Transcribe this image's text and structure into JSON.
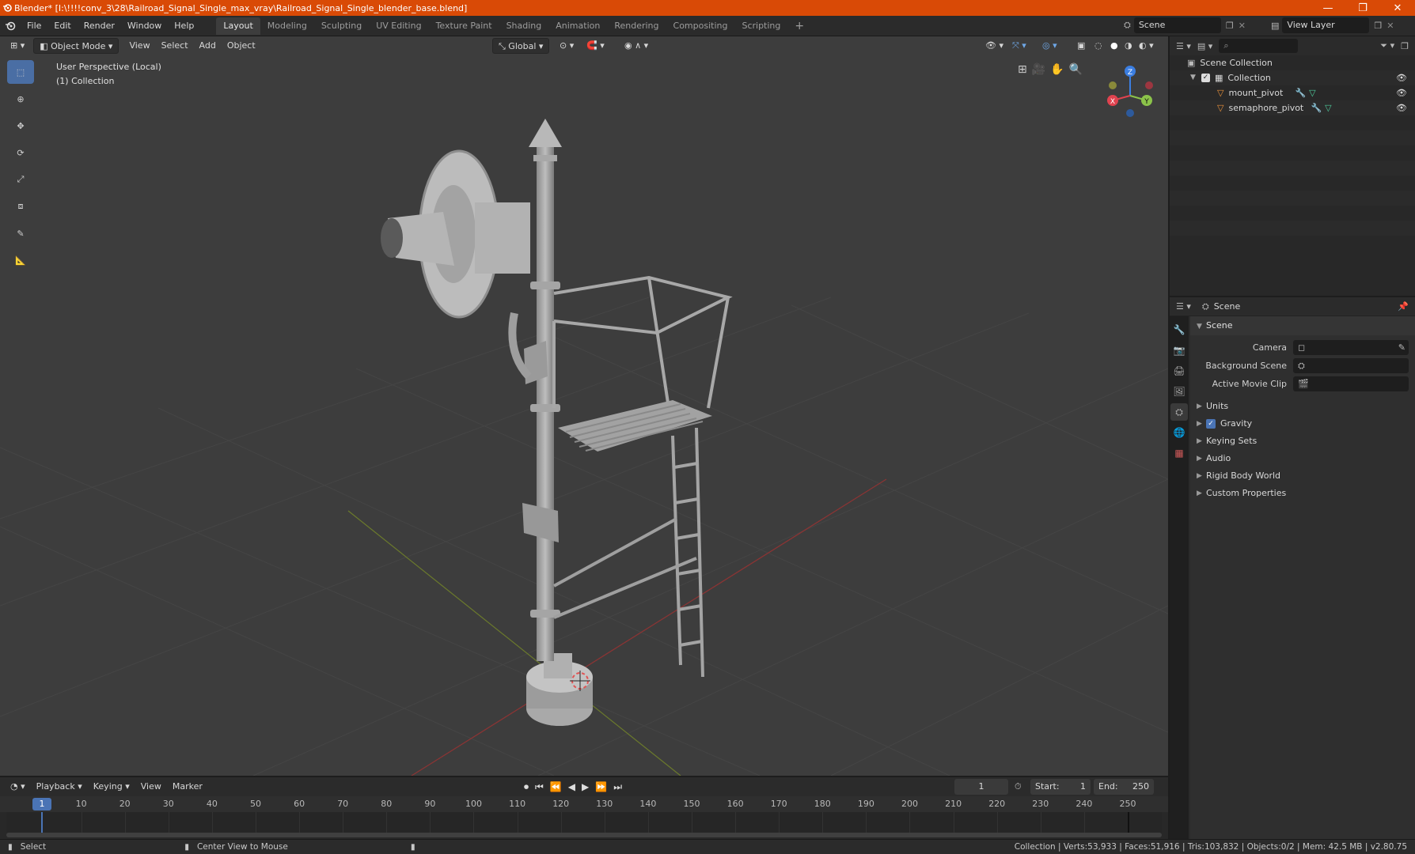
{
  "window": {
    "title": "Blender* [I:\\!!!!conv_3\\28\\Railroad_Signal_Single_max_vray\\Railroad_Signal_Single_blender_base.blend]",
    "controls": [
      "—",
      "❐",
      "✕"
    ]
  },
  "menubar": {
    "menus": [
      "File",
      "Edit",
      "Render",
      "Window",
      "Help"
    ],
    "workspaces": [
      "Layout",
      "Modeling",
      "Sculpting",
      "UV Editing",
      "Texture Paint",
      "Shading",
      "Animation",
      "Rendering",
      "Compositing",
      "Scripting"
    ],
    "active_workspace": "Layout",
    "add_workspace": "+",
    "scene": "Scene",
    "view_layer": "View Layer"
  },
  "viewport": {
    "mode": "Object Mode",
    "menus": [
      "View",
      "Select",
      "Add",
      "Object"
    ],
    "transform_orientation": "Global",
    "info_line1": "User Perspective (Local)",
    "info_line2": "(1) Collection",
    "gizmo_axes": [
      "Z",
      "Y",
      "X"
    ]
  },
  "outliner": {
    "root": "Scene Collection",
    "collection": "Collection",
    "objects": [
      "mount_pivot",
      "semaphore_pivot"
    ]
  },
  "properties": {
    "header": "Scene",
    "panel": "Scene",
    "fields": [
      {
        "label": "Camera",
        "value": ""
      },
      {
        "label": "Background Scene",
        "value": ""
      },
      {
        "label": "Active Movie Clip",
        "value": ""
      }
    ],
    "subpanels": [
      "Units",
      "Gravity",
      "Keying Sets",
      "Audio",
      "Rigid Body World",
      "Custom Properties"
    ],
    "gravity_checked": true
  },
  "timeline": {
    "menus": [
      "Playback",
      "Keying",
      "View",
      "Marker"
    ],
    "current_frame": "1",
    "start_label": "Start:",
    "start": "1",
    "end_label": "End:",
    "end": "250",
    "ticks": [
      "10",
      "20",
      "30",
      "40",
      "50",
      "60",
      "70",
      "80",
      "90",
      "100",
      "110",
      "120",
      "130",
      "140",
      "150",
      "160",
      "170",
      "180",
      "190",
      "200",
      "210",
      "220",
      "230",
      "240",
      "250"
    ],
    "cursor_frame": "1"
  },
  "statusbar": {
    "select": "Select",
    "center_view": "Center View to Mouse",
    "stats": "Collection | Verts:53,933 | Faces:51,916 | Tris:103,832 | Objects:0/2 | Mem: 42.5 MB | v2.80.75"
  },
  "colors": {
    "titlebar": "#d94a06",
    "accent": "#4a74b5",
    "viewport_bg": "#3d3d3d",
    "x_axis": "#e0434f",
    "y_axis": "#8bc34a",
    "z_axis": "#3b7ee1"
  }
}
